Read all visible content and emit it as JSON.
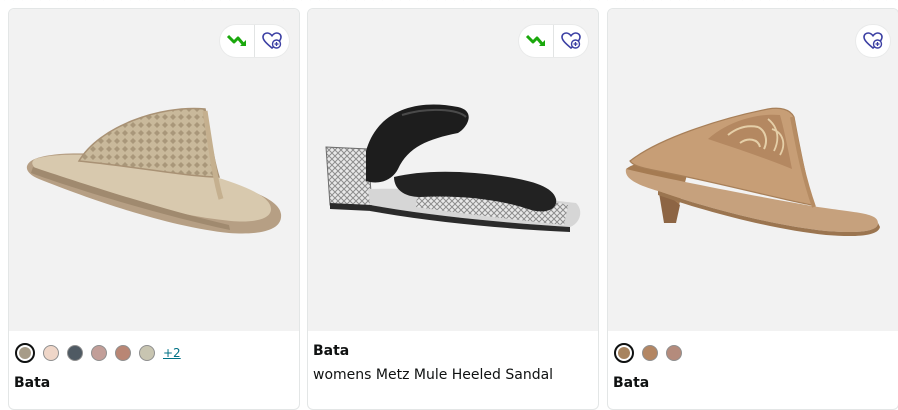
{
  "products": [
    {
      "brand": "Bata",
      "swatches": [
        "#a79c88",
        "#efd6c8",
        "#4f5a63",
        "#c29e98",
        "#b98674",
        "#c8c5b1"
      ],
      "more_colors": "+2",
      "icons": [
        "price-drop-icon",
        "wishlist-heart-icon"
      ]
    },
    {
      "brand": "Bata",
      "title": "womens Metz Mule Heeled Sandal",
      "icons": [
        "price-drop-icon",
        "wishlist-heart-icon"
      ]
    },
    {
      "brand": "Bata",
      "swatches": [
        "#a8845f",
        "#b38663",
        "#b48b7c"
      ],
      "icons": [
        "wishlist-heart-icon"
      ]
    }
  ],
  "colors": {
    "price_drop_green": "#1aa80c",
    "wishlist_purple": "#3b3fa3",
    "link_teal": "#007185"
  }
}
